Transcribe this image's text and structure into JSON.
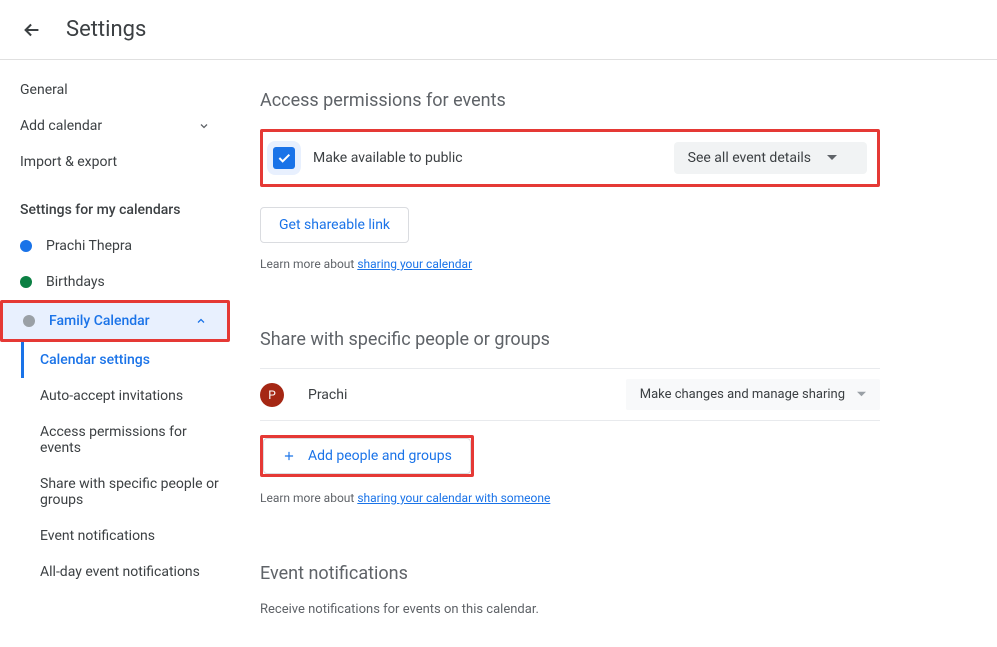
{
  "header": {
    "title": "Settings"
  },
  "sidebar": {
    "top": [
      {
        "label": "General"
      },
      {
        "label": "Add calendar"
      },
      {
        "label": "Import & export"
      }
    ],
    "section_label": "Settings for my calendars",
    "calendars": [
      {
        "label": "Prachi Thepra"
      },
      {
        "label": "Birthdays"
      },
      {
        "label": "Family Calendar"
      }
    ],
    "sub": [
      {
        "label": "Calendar settings"
      },
      {
        "label": "Auto-accept invitations"
      },
      {
        "label": "Access permissions for events"
      },
      {
        "label": "Share with specific people or groups"
      },
      {
        "label": "Event notifications"
      },
      {
        "label": "All-day event notifications"
      }
    ]
  },
  "access": {
    "title": "Access permissions for events",
    "checkbox_label": "Make available to public",
    "select_label": "See all event details",
    "shareable_btn": "Get shareable link",
    "help_prefix": "Learn more about ",
    "help_link": "sharing your calendar"
  },
  "share": {
    "title": "Share with specific people or groups",
    "person_name": "Prachi",
    "person_initial": "P",
    "select_label": "Make changes and manage sharing",
    "add_btn": "Add people and groups",
    "help_prefix": "Learn more about ",
    "help_link": "sharing your calendar with someone"
  },
  "notify": {
    "title": "Event notifications",
    "desc": "Receive notifications for events on this calendar."
  }
}
